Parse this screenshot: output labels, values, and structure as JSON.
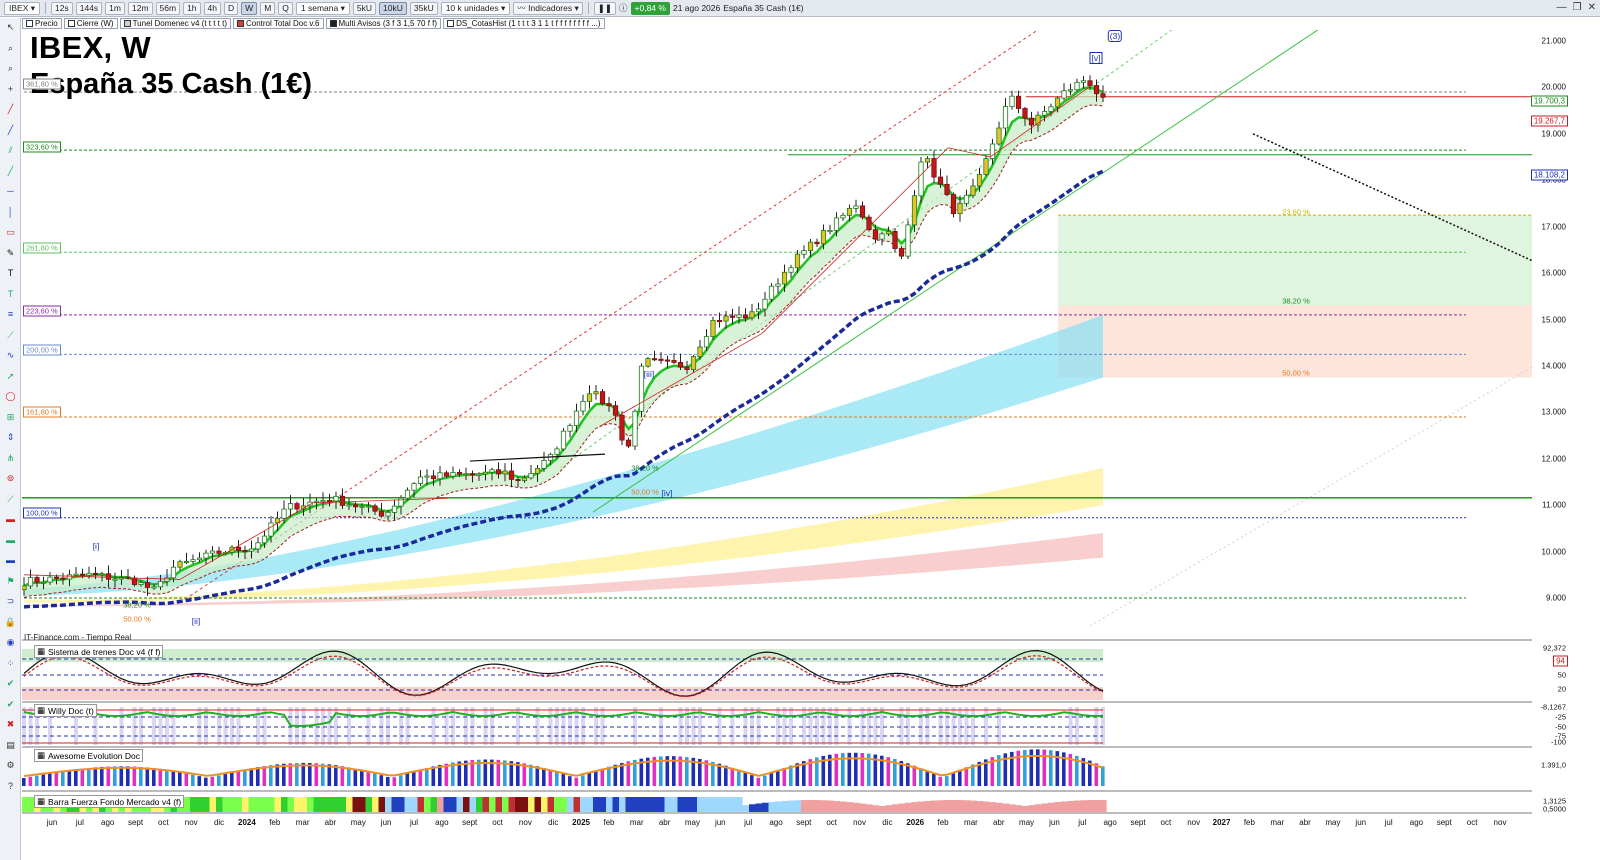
{
  "toolbar": {
    "symbol": "IBEX",
    "timeframes": [
      "12s",
      "144s",
      "1m",
      "12m",
      "56m",
      "1h",
      "4h",
      "D",
      "W",
      "M",
      "Q"
    ],
    "active_timeframe": "W",
    "period": "1 semana",
    "units_buttons": [
      "5kU",
      "10kU",
      "35kU"
    ],
    "active_units": "10kU",
    "units_dropdown": "10 k unidades",
    "indicators_label": "Indicadores",
    "change_badge": "+0,84 %",
    "date": "21 ago 2026",
    "instrument": "España 35 Cash (1€)"
  },
  "indicator_strip": [
    {
      "label": "Precio",
      "color": "#ffffff"
    },
    {
      "label": "Cierre (W)",
      "color": "#ffffff"
    },
    {
      "label": "Tunel Domenec v4 (t t t t t)",
      "color": "#d0d0d0"
    },
    {
      "label": "Control Total Doc v.6",
      "color": "#d04040"
    },
    {
      "label": "Multi Avisos (3 f 3 1,5 70 f f)",
      "color": "#202020"
    },
    {
      "label": "DS_CotasHist (1 t t t 3 1 1 t f f f f f f f f ...)",
      "color": "#ffffff"
    }
  ],
  "chart": {
    "title": "IBEX, W",
    "subtitle": "España 35 Cash (1€)",
    "watermark": "IT-Finance.com - Tiempo Real",
    "y_ticks": [
      "21.000",
      "20.000",
      "19.000",
      "18.000",
      "17.000",
      "16.000",
      "15.000",
      "14.000",
      "13.000",
      "12.000",
      "11.000",
      "10.000",
      "9.000"
    ],
    "price_tags": [
      {
        "text": "19.700,3",
        "color": "#1a8a1a"
      },
      {
        "text": "19.267,7",
        "color": "#c02020"
      },
      {
        "text": "18.108,2",
        "color": "#1e2fb5"
      }
    ],
    "fib_left": [
      {
        "text": "361,80 %",
        "color": "#808080"
      },
      {
        "text": "323,60 %",
        "color": "#1a8a1a"
      },
      {
        "text": "261,80 %",
        "color": "#5cc05c"
      },
      {
        "text": "223,60 %",
        "color": "#8a2aa0"
      },
      {
        "text": "200,00 %",
        "color": "#6a8ad0"
      },
      {
        "text": "161,80 %",
        "color": "#e07a20"
      },
      {
        "text": "100,00 %",
        "color": "#1e2fb5"
      }
    ],
    "fib_mid": [
      {
        "text": "23,60 %",
        "color": "#c8b400"
      },
      {
        "text": "38,20 %",
        "color": "#1a8a1a"
      },
      {
        "text": "50,00 %",
        "color": "#e07a20"
      },
      {
        "text": "38,20 %",
        "color": "#1a8a1a"
      },
      {
        "text": "50,00 %",
        "color": "#e07a20"
      },
      {
        "text": "38,20 %",
        "color": "#1a8a1a"
      },
      {
        "text": "50,00 %",
        "color": "#e07a20"
      }
    ],
    "waves": [
      "[i]",
      "[ii]",
      "[iii]",
      "[iv]",
      "[v]",
      "(3)"
    ]
  },
  "panels": [
    {
      "name": "Sistema de trenes Doc v4 (f f)",
      "ticks": [
        "92,372",
        "80",
        "50",
        "20"
      ],
      "value_tag": "94"
    },
    {
      "name": "Willy Doc (t)",
      "ticks": [
        "-8,1267",
        "-25",
        "-50",
        "-75",
        "-100"
      ]
    },
    {
      "name": "Awesome Evolution Doc",
      "ticks": [
        "1.391,0"
      ]
    },
    {
      "name": "Barra Fuerza Fondo Mercado v4 (f)",
      "ticks": [
        "1,3125",
        "0,5000"
      ]
    }
  ],
  "x_axis": [
    "jun",
    "jul",
    "ago",
    "sept",
    "oct",
    "nov",
    "dic",
    "2024",
    "feb",
    "mar",
    "abr",
    "may",
    "jun",
    "jul",
    "ago",
    "sept",
    "oct",
    "nov",
    "dic",
    "2025",
    "feb",
    "mar",
    "abr",
    "may",
    "jun",
    "jul",
    "ago",
    "sept",
    "oct",
    "nov",
    "dic",
    "2026",
    "feb",
    "mar",
    "abr",
    "may",
    "jun",
    "jul",
    "ago",
    "sept",
    "oct",
    "nov",
    "2027",
    "feb",
    "mar",
    "abr",
    "may",
    "jun",
    "jul",
    "ago",
    "sept",
    "oct",
    "nov"
  ],
  "colors": {
    "bull_candle": "#1a9a1a",
    "bear_candle": "#c01818",
    "fast_ma": "#22c322",
    "slow_ma": "#1b2a9a",
    "accent_red": "#e02020"
  }
}
